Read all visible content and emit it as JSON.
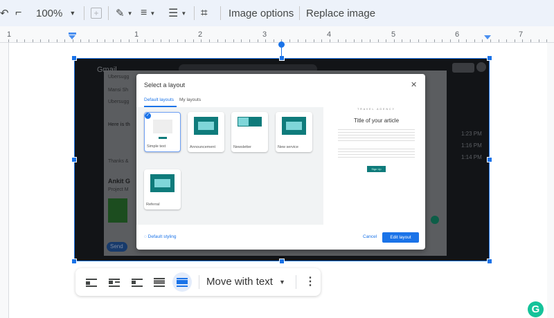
{
  "toolbar": {
    "zoom": "100%",
    "image_options": "Image options",
    "replace_image": "Replace image",
    "icons": [
      "undo-icon",
      "paint-format-icon",
      "add-comment-icon",
      "border-color-icon",
      "border-weight-icon",
      "border-dash-icon",
      "crop-icon"
    ]
  },
  "ruler": {
    "labels": [
      "1",
      "1",
      "2",
      "3",
      "4",
      "5",
      "6",
      "7"
    ]
  },
  "embedded_screenshot": {
    "app": "Gmail",
    "left_texts": [
      "Ubersugg",
      "Mansi Sh",
      "Ubersugg",
      "Here is th",
      "Thanks &",
      "Ankit G",
      "Project M",
      "Send"
    ],
    "times": [
      "1:23 PM",
      "1:16 PM",
      "1:14 PM"
    ],
    "dialog": {
      "title": "Select a layout",
      "tabs": [
        {
          "label": "Default layouts",
          "active": true
        },
        {
          "label": "My layouts",
          "active": false
        }
      ],
      "layouts": [
        {
          "label": "Simple text",
          "selected": true
        },
        {
          "label": "Announcement"
        },
        {
          "label": "Newsletter"
        },
        {
          "label": "New service"
        },
        {
          "label": "Referral"
        }
      ],
      "preview": {
        "brand": "TRAVEL AGENCY",
        "title": "Title of your article",
        "button": "Sign Up"
      },
      "default_styling": "Default styling",
      "cancel": "Cancel",
      "edit_layout": "Edit layout",
      "accent": "#1a73e8"
    }
  },
  "image_toolbar": {
    "wrap_modes": [
      "inline",
      "wrap-text",
      "break-text",
      "behind-text",
      "in-front-of-text"
    ],
    "active_wrap": "in-front-of-text",
    "position": "Move with text"
  }
}
